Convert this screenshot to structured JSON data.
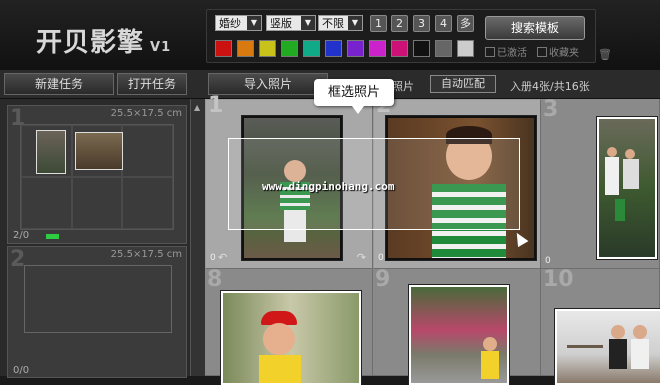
{
  "app": {
    "title": "开贝影擎",
    "version": "V1"
  },
  "filters": {
    "category": "婚纱",
    "orientation": "竖版",
    "limit": "不限",
    "photo_counts": [
      "1",
      "2",
      "3",
      "4",
      "多"
    ],
    "colors": [
      "#cc1111",
      "#d97a10",
      "#c8c21a",
      "#22aa22",
      "#11aa88",
      "#2233cc",
      "#7722cc",
      "#cc22cc",
      "#cc1177",
      "#111111",
      "#666666",
      "#cccccc"
    ],
    "search_label": "搜索模板",
    "activated_label": "已激活",
    "favorites_label": "收藏夹"
  },
  "toolbar": {
    "new_task": "新建任务",
    "open_task": "打开任务",
    "import_photos": "导入照片",
    "select_photos_partial": "照片",
    "auto_match": "自动匹配",
    "count_text": "入册4张/共16张"
  },
  "tasks": [
    {
      "number": "1",
      "size": "25.5×17.5 cm",
      "ratio": "2/0"
    },
    {
      "number": "2",
      "size": "25.5×17.5 cm",
      "ratio": "0/0"
    }
  ],
  "photos": [
    {
      "number": "1",
      "zero": "0"
    },
    {
      "number": "2",
      "zero": "0"
    },
    {
      "number": "3",
      "zero": "0"
    },
    {
      "number": "8"
    },
    {
      "number": "9"
    },
    {
      "number": "10"
    }
  ],
  "tooltip": "框选照片",
  "watermark": "www.dingpinohang.com"
}
